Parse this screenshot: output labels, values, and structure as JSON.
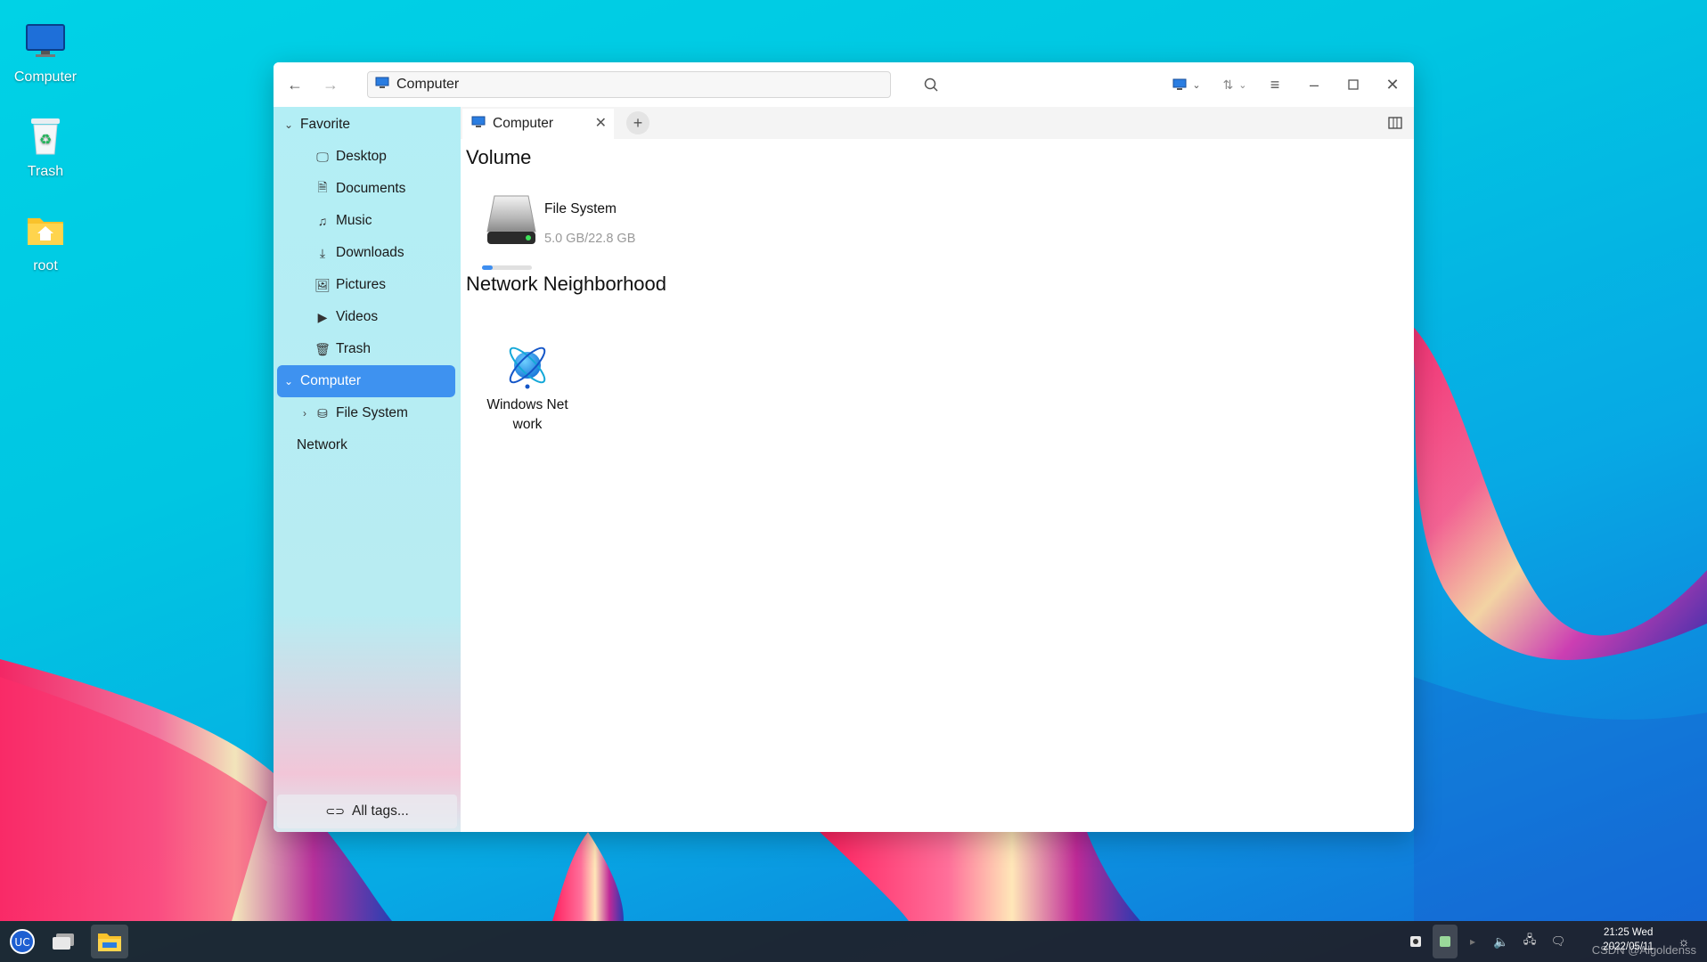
{
  "desktop": {
    "icons": [
      {
        "label": "Computer",
        "icon": "computer-icon"
      },
      {
        "label": "Trash",
        "icon": "trash-icon"
      },
      {
        "label": "root",
        "icon": "home-folder-icon"
      }
    ]
  },
  "window": {
    "address": "Computer",
    "sidebar": {
      "favorite_label": "Favorite",
      "items": [
        {
          "label": "Desktop",
          "icon": "desktop-icon"
        },
        {
          "label": "Documents",
          "icon": "documents-icon"
        },
        {
          "label": "Music",
          "icon": "music-icon"
        },
        {
          "label": "Downloads",
          "icon": "downloads-icon"
        },
        {
          "label": "Pictures",
          "icon": "pictures-icon"
        },
        {
          "label": "Videos",
          "icon": "videos-icon"
        },
        {
          "label": "Trash",
          "icon": "trash-icon"
        }
      ],
      "computer_label": "Computer",
      "filesystem_label": "File System",
      "network_label": "Network",
      "all_tags": "All tags..."
    },
    "tabs": [
      {
        "label": "Computer"
      }
    ],
    "content": {
      "volume_heading": "Volume",
      "volume": {
        "name": "File System",
        "size": "5.0 GB/22.8 GB",
        "used_fraction": 0.22
      },
      "network_heading": "Network Neighborhood",
      "network_item": {
        "name_line1": "Windows Net",
        "name_line2": "work"
      }
    }
  },
  "taskbar": {
    "time": "21:25 Wed",
    "date": "2022/05/11",
    "watermark": "CSDN @Algoldenss",
    "accent": "#3e92f0"
  }
}
